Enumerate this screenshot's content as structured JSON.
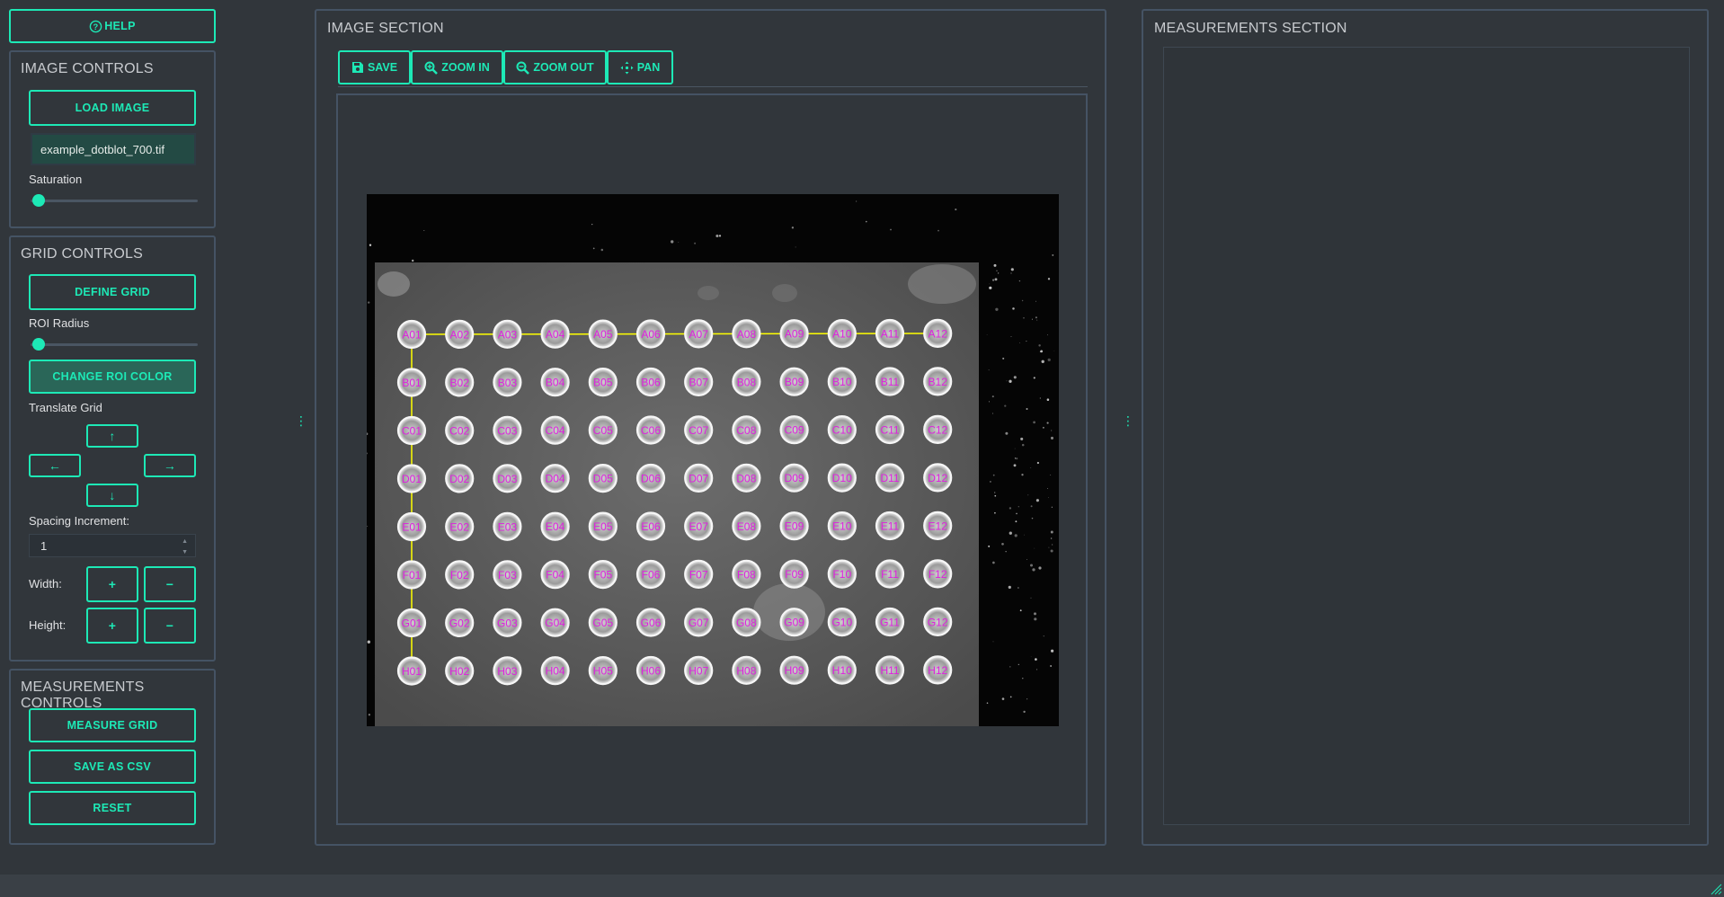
{
  "help_button": "HELP",
  "image_controls": {
    "title": "IMAGE CONTROLS",
    "load_button": "LOAD IMAGE",
    "file_name": "example_dotblot_700.tif",
    "saturation_label": "Saturation",
    "saturation_value": 0.0
  },
  "grid_controls": {
    "title": "GRID CONTROLS",
    "define_button": "DEFINE GRID",
    "roi_radius_label": "ROI Radius",
    "roi_radius_value": 0.0,
    "change_color_button": "CHANGE ROI COLOR",
    "translate_label": "Translate Grid",
    "up": "↑",
    "down": "↓",
    "left": "←",
    "right": "→",
    "spacing_label": "Spacing Increment:",
    "spacing_value": "1",
    "width_label": "Width:",
    "height_label": "Height:",
    "plus": "+",
    "minus": "−"
  },
  "measurement_controls": {
    "title": "MEASUREMENTS CONTROLS",
    "measure_button": "MEASURE GRID",
    "save_csv_button": "SAVE AS CSV",
    "reset_button": "RESET"
  },
  "image_section": {
    "title": "IMAGE SECTION",
    "toolbar": {
      "save": "SAVE",
      "zoom_in": "ZOOM IN",
      "zoom_out": "ZOOM OUT",
      "pan": "PAN"
    }
  },
  "measurements_section": {
    "title": "MEASUREMENTS SECTION"
  },
  "grid": {
    "rows": [
      "A",
      "B",
      "C",
      "D",
      "E",
      "F",
      "G",
      "H"
    ],
    "cols": [
      "01",
      "02",
      "03",
      "04",
      "05",
      "06",
      "07",
      "08",
      "09",
      "10",
      "11",
      "12"
    ],
    "label_color": "#e020e0",
    "line_color": "#ffff00"
  },
  "colors": {
    "accent": "#1de9b6",
    "background": "#31363b",
    "border": "#455364"
  }
}
